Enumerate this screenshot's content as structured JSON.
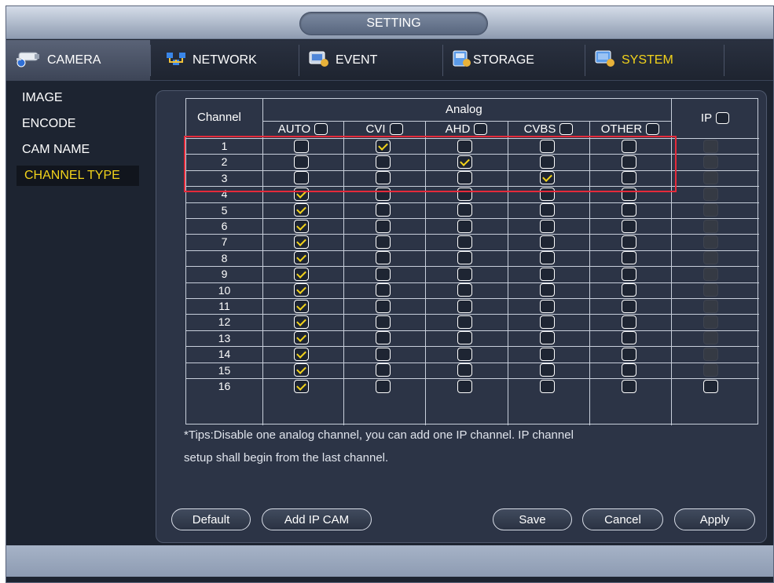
{
  "window": {
    "title": "SETTING"
  },
  "nav": {
    "tabs": [
      {
        "label": "CAMERA",
        "icon": "camera-icon"
      },
      {
        "label": "NETWORK",
        "icon": "network-icon"
      },
      {
        "label": "EVENT",
        "icon": "event-icon"
      },
      {
        "label": "STORAGE",
        "icon": "storage-icon"
      },
      {
        "label": "SYSTEM",
        "icon": "system-icon"
      }
    ]
  },
  "menu": {
    "items": [
      "IMAGE",
      "ENCODE",
      "CAM NAME",
      "CHANNEL TYPE"
    ],
    "selected": "CHANNEL TYPE"
  },
  "table": {
    "header_channel": "Channel",
    "header_group": "Analog",
    "columns": [
      "AUTO",
      "CVI",
      "AHD",
      "CVBS",
      "OTHER"
    ],
    "header_ip": "IP",
    "rows": [
      {
        "channel": "1",
        "selected": "CVI",
        "ip": "disabled"
      },
      {
        "channel": "2",
        "selected": "AHD",
        "ip": "disabled"
      },
      {
        "channel": "3",
        "selected": "CVBS",
        "ip": "disabled"
      },
      {
        "channel": "4",
        "selected": "AUTO",
        "ip": "disabled"
      },
      {
        "channel": "5",
        "selected": "AUTO",
        "ip": "disabled"
      },
      {
        "channel": "6",
        "selected": "AUTO",
        "ip": "disabled"
      },
      {
        "channel": "7",
        "selected": "AUTO",
        "ip": "disabled"
      },
      {
        "channel": "8",
        "selected": "AUTO",
        "ip": "disabled"
      },
      {
        "channel": "9",
        "selected": "AUTO",
        "ip": "disabled"
      },
      {
        "channel": "10",
        "selected": "AUTO",
        "ip": "disabled"
      },
      {
        "channel": "11",
        "selected": "AUTO",
        "ip": "disabled"
      },
      {
        "channel": "12",
        "selected": "AUTO",
        "ip": "disabled"
      },
      {
        "channel": "13",
        "selected": "AUTO",
        "ip": "disabled"
      },
      {
        "channel": "14",
        "selected": "AUTO",
        "ip": "disabled"
      },
      {
        "channel": "15",
        "selected": "AUTO",
        "ip": "disabled"
      },
      {
        "channel": "16",
        "selected": "AUTO",
        "ip": "enabled"
      }
    ]
  },
  "tips": {
    "line1": "*Tips:Disable one analog channel, you can add one IP channel. IP channel",
    "line2": "setup shall begin from the last channel."
  },
  "buttons": {
    "default": "Default",
    "add_ip_cam": "Add IP CAM",
    "save": "Save",
    "cancel": "Cancel",
    "apply": "Apply"
  },
  "colors": {
    "accent": "#f2d31b",
    "highlight_box": "#e52a3a",
    "background": "#1d2431"
  }
}
